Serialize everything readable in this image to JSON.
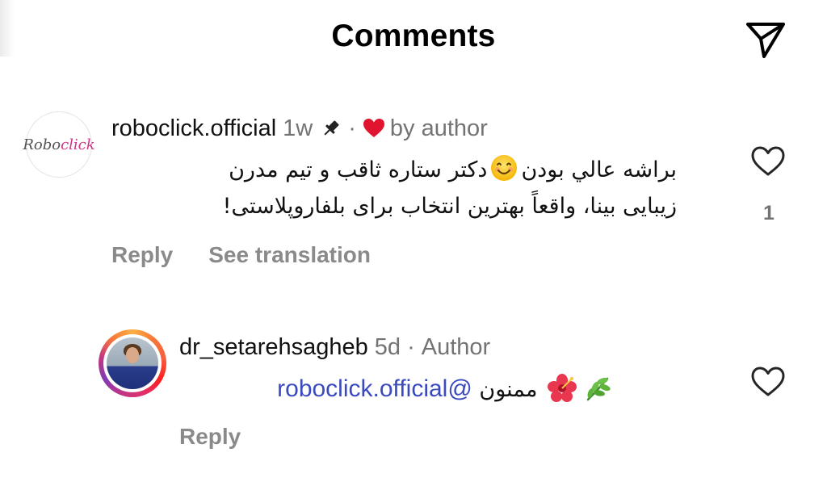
{
  "header": {
    "title": "Comments",
    "send_icon": "paper-plane-icon"
  },
  "comments": [
    {
      "username": "roboclick.official",
      "time": "1w",
      "dot": "·",
      "badge": "by author",
      "avatar_text_a": "Robo",
      "avatar_text_b": "click",
      "body_line1": "براشه عالي بودن",
      "body_line1b": "دکتر ستاره ثاقب و تیم مدرن",
      "body_line2": "زیبایی بینا، واقعاً بهترین انتخاب برای بلفاروپلاستی!",
      "reply_label": "Reply",
      "translate_label": "See translation",
      "likes": "1"
    },
    {
      "username": "dr_setarehsagheb",
      "time": "5d",
      "dot": "·",
      "badge": "Author",
      "mention": "@roboclick.official",
      "body": "ممنون",
      "reply_label": "Reply"
    }
  ],
  "colors": {
    "mention": "#3b4bbf",
    "heart": "#e0142e",
    "muted": "#737373"
  }
}
